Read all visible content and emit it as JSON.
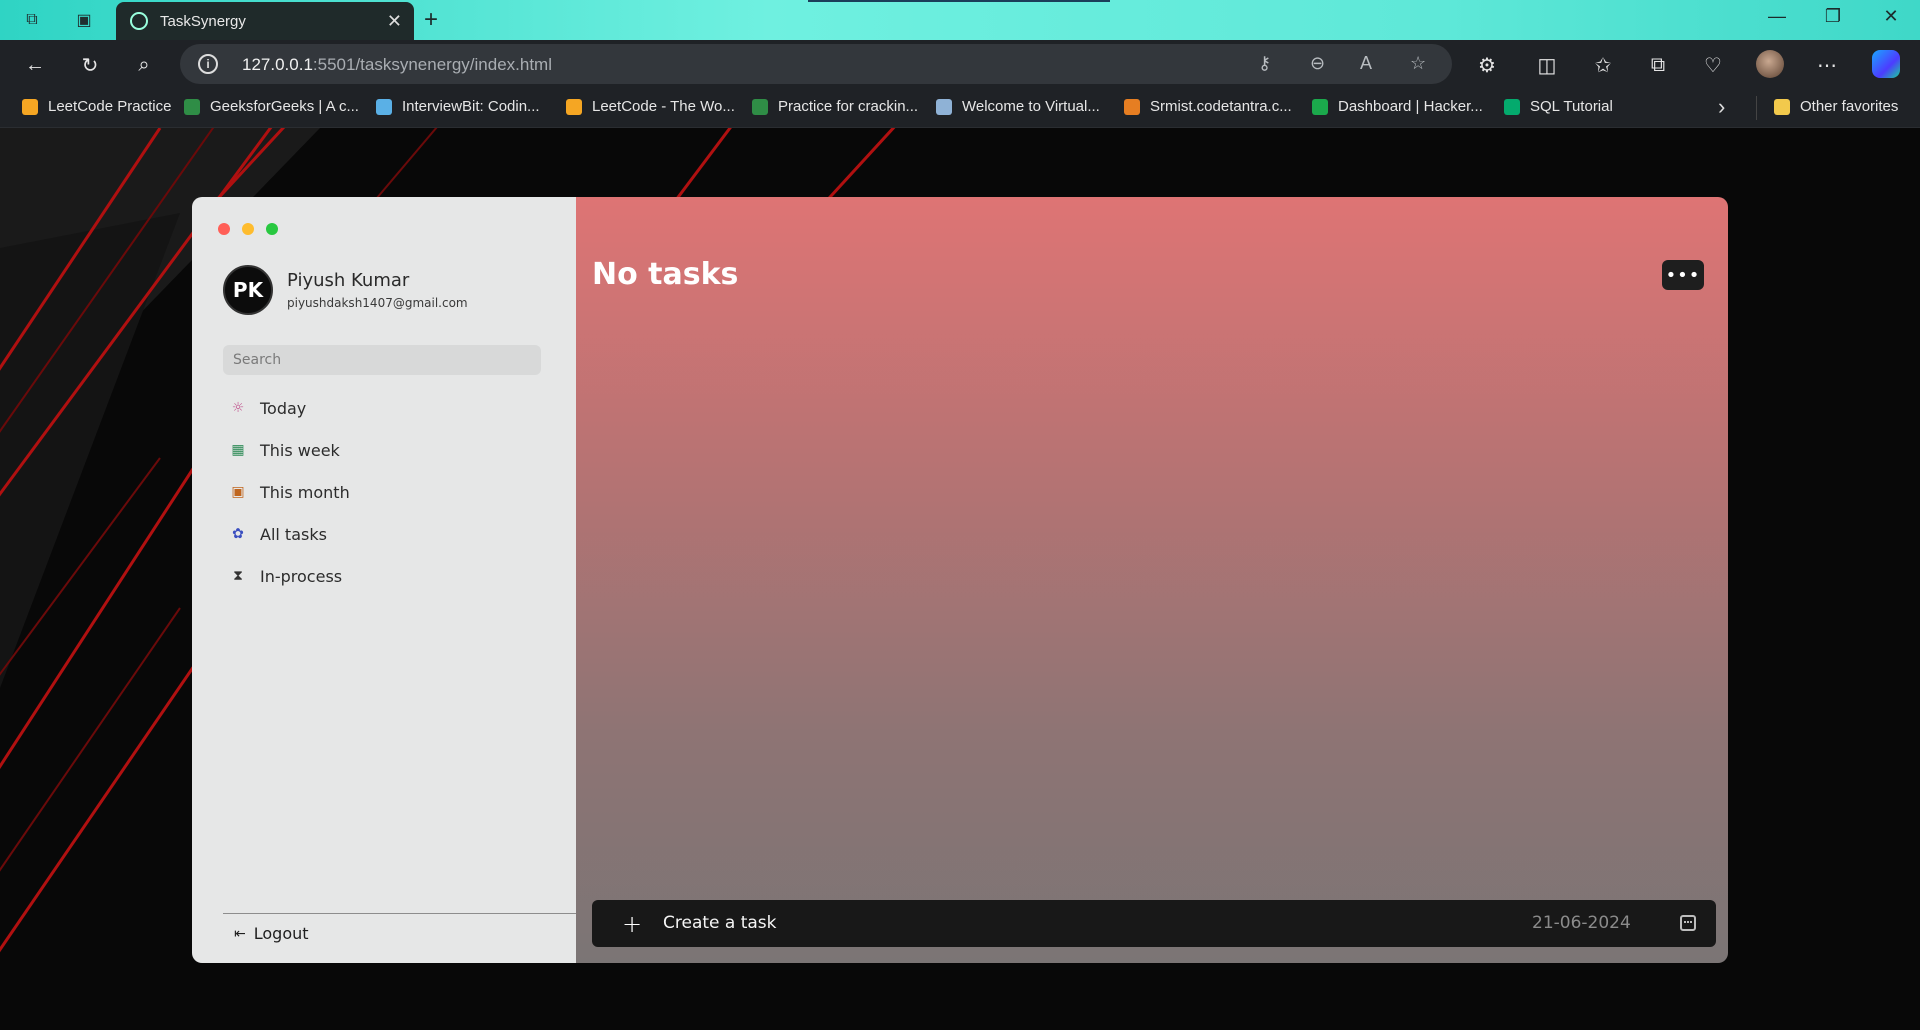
{
  "browser": {
    "tab_title": "TaskSynergy",
    "url_host": "127.0.0.1",
    "url_rest": ":5501/tasksynenergy/index.html",
    "favorites": [
      {
        "label": "LeetCode Practice",
        "color": "#f5a623"
      },
      {
        "label": "GeeksforGeeks | A c...",
        "color": "#2f8d46"
      },
      {
        "label": "InterviewBit: Codin...",
        "color": "#5ab0e6"
      },
      {
        "label": "LeetCode - The Wo...",
        "color": "#f5a623"
      },
      {
        "label": "Practice for crackin...",
        "color": "#2f8d46"
      },
      {
        "label": "Welcome to Virtual...",
        "color": "#8fb2d6"
      },
      {
        "label": "Srmist.codetantra.c...",
        "color": "#e67e22"
      },
      {
        "label": "Dashboard | Hacker...",
        "color": "#1ba94c"
      },
      {
        "label": "SQL Tutorial",
        "color": "#04aa6d"
      }
    ],
    "other_favorites": "Other favorites"
  },
  "app": {
    "profile": {
      "initials": "PK",
      "name": "Piyush Kumar",
      "email": "piyushdaksh1407@gmail.com"
    },
    "search_placeholder": "Search",
    "nav": [
      {
        "label": "Today",
        "icon": "sun-icon",
        "color": "#c0508c"
      },
      {
        "label": "This week",
        "icon": "grid-icon",
        "color": "#2e8b57"
      },
      {
        "label": "This month",
        "icon": "calendar-icon",
        "color": "#c0661e"
      },
      {
        "label": "All tasks",
        "icon": "puzzle-icon",
        "color": "#3a4ec0"
      },
      {
        "label": "In-process",
        "icon": "hourglass-icon",
        "color": "#333333"
      }
    ],
    "logout_label": "Logout",
    "main": {
      "title": "No tasks",
      "create_label": "Create a task",
      "date": "21-06-2024"
    }
  },
  "colors": {
    "window_red": "#ff5f57",
    "window_yellow": "#febc2e",
    "window_green": "#28c840",
    "main_gradient_top": "#de7474",
    "main_gradient_bottom": "#7b7575"
  }
}
